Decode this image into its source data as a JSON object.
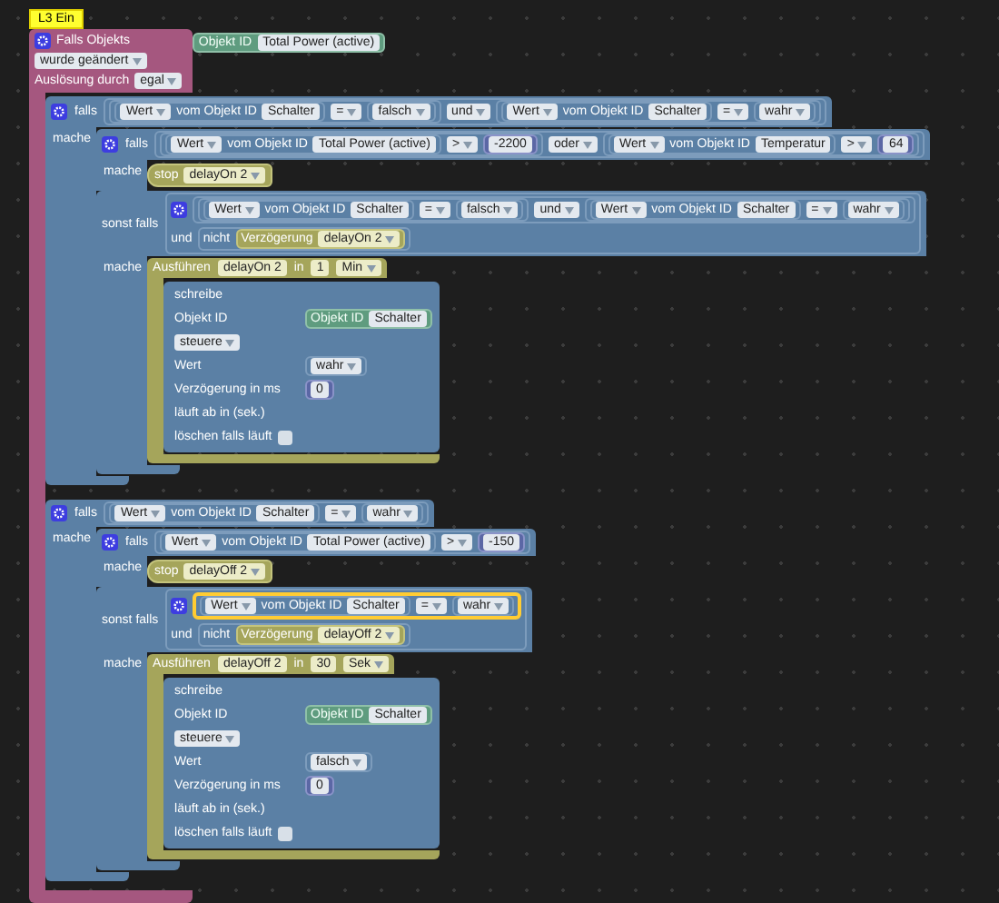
{
  "comment": {
    "text": "L3 Ein"
  },
  "trigger": {
    "gear": true,
    "title": "Falls Objekts",
    "object": {
      "kind": "object_ref",
      "label": "Objekt ID",
      "object": "Total Power (active)"
    },
    "event": "wurde geändert",
    "cause_label": "Auslösung durch",
    "cause": "egal",
    "statements": [
      {
        "kind": "if",
        "clauses": [
          {
            "gear": true,
            "label": "falls",
            "condition": {
              "kind": "logic",
              "inline": true,
              "op": "und",
              "a": {
                "kind": "compare",
                "selected": false,
                "left": {
                  "kind": "get",
                  "field": "Wert",
                  "label": "vom Objekt ID",
                  "object": "Schalter"
                },
                "op": "=",
                "right": {
                  "kind": "bool",
                  "text": "falsch"
                }
              },
              "b": {
                "kind": "compare",
                "selected": false,
                "left": {
                  "kind": "get",
                  "field": "Wert",
                  "label": "vom Objekt ID",
                  "object": "Schalter"
                },
                "op": "=",
                "right": {
                  "kind": "bool",
                  "text": "wahr"
                }
              }
            },
            "do_label": "mache",
            "statements": [
              {
                "kind": "if",
                "clauses": [
                  {
                    "gear": true,
                    "label": "falls",
                    "condition": {
                      "kind": "logic",
                      "inline": true,
                      "op": "oder",
                      "a": {
                        "kind": "compare",
                        "selected": false,
                        "left": {
                          "kind": "get",
                          "field": "Wert",
                          "label": "vom Objekt ID",
                          "object": "Total Power (active)"
                        },
                        "op": ">",
                        "right": {
                          "kind": "number",
                          "text": "-2200"
                        }
                      },
                      "b": {
                        "kind": "compare",
                        "selected": false,
                        "left": {
                          "kind": "get",
                          "field": "Wert",
                          "label": "vom Objekt ID",
                          "object": "Temperatur"
                        },
                        "op": ">",
                        "right": {
                          "kind": "number",
                          "text": "64"
                        }
                      }
                    },
                    "do_label": "mache",
                    "statements": [
                      {
                        "kind": "stop",
                        "label": "stop",
                        "name": "delayOn 2"
                      }
                    ]
                  },
                  {
                    "gear": false,
                    "label": "sonst falls",
                    "condition": {
                      "kind": "logic",
                      "inline": false,
                      "gear": true,
                      "op": "und",
                      "a": {
                        "kind": "logic",
                        "inline": true,
                        "op": "und",
                        "a": {
                          "kind": "compare",
                          "selected": false,
                          "left": {
                            "kind": "get",
                            "field": "Wert",
                            "label": "vom Objekt ID",
                            "object": "Schalter"
                          },
                          "op": "=",
                          "right": {
                            "kind": "bool",
                            "text": "falsch"
                          }
                        },
                        "b": {
                          "kind": "compare",
                          "selected": false,
                          "left": {
                            "kind": "get",
                            "field": "Wert",
                            "label": "vom Objekt ID",
                            "object": "Schalter"
                          },
                          "op": "=",
                          "right": {
                            "kind": "bool",
                            "text": "wahr"
                          }
                        }
                      },
                      "b": {
                        "kind": "not",
                        "label": "nicht",
                        "operand": {
                          "kind": "timer",
                          "label": "Verzögerung",
                          "name": "delayOn 2"
                        }
                      }
                    },
                    "do_label": "mache",
                    "statements": [
                      {
                        "kind": "timeout",
                        "label": "Ausführen",
                        "name": "delayOn 2",
                        "in_label": "in",
                        "delay": "1",
                        "unit": "Min",
                        "statements": [
                          {
                            "kind": "write",
                            "title": "schreibe",
                            "id_label": "Objekt ID",
                            "id": {
                              "kind": "object_ref",
                              "label": "Objekt ID",
                              "object": "Schalter"
                            },
                            "mode": "steuere",
                            "value_label": "Wert",
                            "value": {
                              "kind": "bool",
                              "text": "wahr"
                            },
                            "delay_label": "Verzögerung in ms",
                            "delay": {
                              "kind": "number",
                              "text": "0"
                            },
                            "expire_label": "läuft ab in (sek.)",
                            "clear_label": "löschen falls läuft",
                            "clear_checked": false
                          }
                        ]
                      }
                    ]
                  }
                ]
              }
            ]
          }
        ]
      },
      {
        "kind": "if",
        "clauses": [
          {
            "gear": true,
            "label": "falls",
            "condition": {
              "kind": "compare",
              "selected": false,
              "left": {
                "kind": "get",
                "field": "Wert",
                "label": "vom Objekt ID",
                "object": "Schalter"
              },
              "op": "=",
              "right": {
                "kind": "bool",
                "text": "wahr"
              }
            },
            "do_label": "mache",
            "statements": [
              {
                "kind": "if",
                "clauses": [
                  {
                    "gear": true,
                    "label": "falls",
                    "condition": {
                      "kind": "compare",
                      "selected": false,
                      "left": {
                        "kind": "get",
                        "field": "Wert",
                        "label": "vom Objekt ID",
                        "object": "Total Power (active)"
                      },
                      "op": ">",
                      "right": {
                        "kind": "number",
                        "text": "-150"
                      }
                    },
                    "do_label": "mache",
                    "statements": [
                      {
                        "kind": "stop",
                        "label": "stop",
                        "name": "delayOff 2"
                      }
                    ]
                  },
                  {
                    "gear": false,
                    "label": "sonst falls",
                    "condition": {
                      "kind": "logic",
                      "inline": false,
                      "gear": true,
                      "op": "und",
                      "a": {
                        "kind": "compare",
                        "selected": true,
                        "left": {
                          "kind": "get",
                          "field": "Wert",
                          "label": "vom Objekt ID",
                          "object": "Schalter"
                        },
                        "op": "=",
                        "right": {
                          "kind": "bool",
                          "text": "wahr"
                        }
                      },
                      "b": {
                        "kind": "not",
                        "label": "nicht",
                        "operand": {
                          "kind": "timer",
                          "label": "Verzögerung",
                          "name": "delayOff 2"
                        }
                      }
                    },
                    "do_label": "mache",
                    "statements": [
                      {
                        "kind": "timeout",
                        "label": "Ausführen",
                        "name": "delayOff 2",
                        "in_label": "in",
                        "delay": "30",
                        "unit": "Sek",
                        "statements": [
                          {
                            "kind": "write",
                            "title": "schreibe",
                            "id_label": "Objekt ID",
                            "id": {
                              "kind": "object_ref",
                              "label": "Objekt ID",
                              "object": "Schalter"
                            },
                            "mode": "steuere",
                            "value_label": "Wert",
                            "value": {
                              "kind": "bool",
                              "text": "falsch"
                            },
                            "delay_label": "Verzögerung in ms",
                            "delay": {
                              "kind": "number",
                              "text": "0"
                            },
                            "expire_label": "läuft ab in (sek.)",
                            "clear_label": "löschen falls läuft",
                            "clear_checked": false
                          }
                        ]
                      }
                    ]
                  }
                ]
              }
            ]
          }
        ]
      }
    ]
  }
}
